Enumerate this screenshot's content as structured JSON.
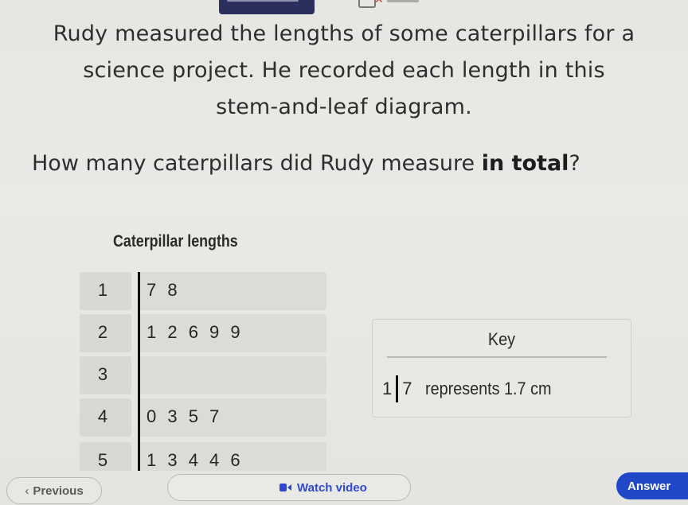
{
  "top_bar": {
    "tab_label": "",
    "icon": "bookmark-x-icon"
  },
  "problem": {
    "intro_lines": [
      "Rudy measured the lengths of some caterpillars for a",
      "science project. He recorded each length in this",
      "stem-and-leaf diagram."
    ],
    "question_prefix": "How many caterpillars did Rudy measure ",
    "question_bold": "in total",
    "question_suffix": "?"
  },
  "stem_leaf": {
    "title": "Caterpillar lengths",
    "rows": [
      {
        "stem": "1",
        "leaves": "7 8"
      },
      {
        "stem": "2",
        "leaves": "1 2 6 9 9"
      },
      {
        "stem": "3",
        "leaves": ""
      },
      {
        "stem": "4",
        "leaves": "0 3 5 7"
      },
      {
        "stem": "5",
        "leaves": "1 3 4 4 6"
      }
    ]
  },
  "key": {
    "title": "Key",
    "stem": "1",
    "leaf": "7",
    "description": "represents 1.7 cm"
  },
  "nav": {
    "previous_label": "Previous",
    "previous_icon": "chevron-left-icon",
    "video_label": "Watch video",
    "video_icon": "video-camera-icon",
    "answer_label": "Answer",
    "accent_color": "#1f47c8"
  }
}
